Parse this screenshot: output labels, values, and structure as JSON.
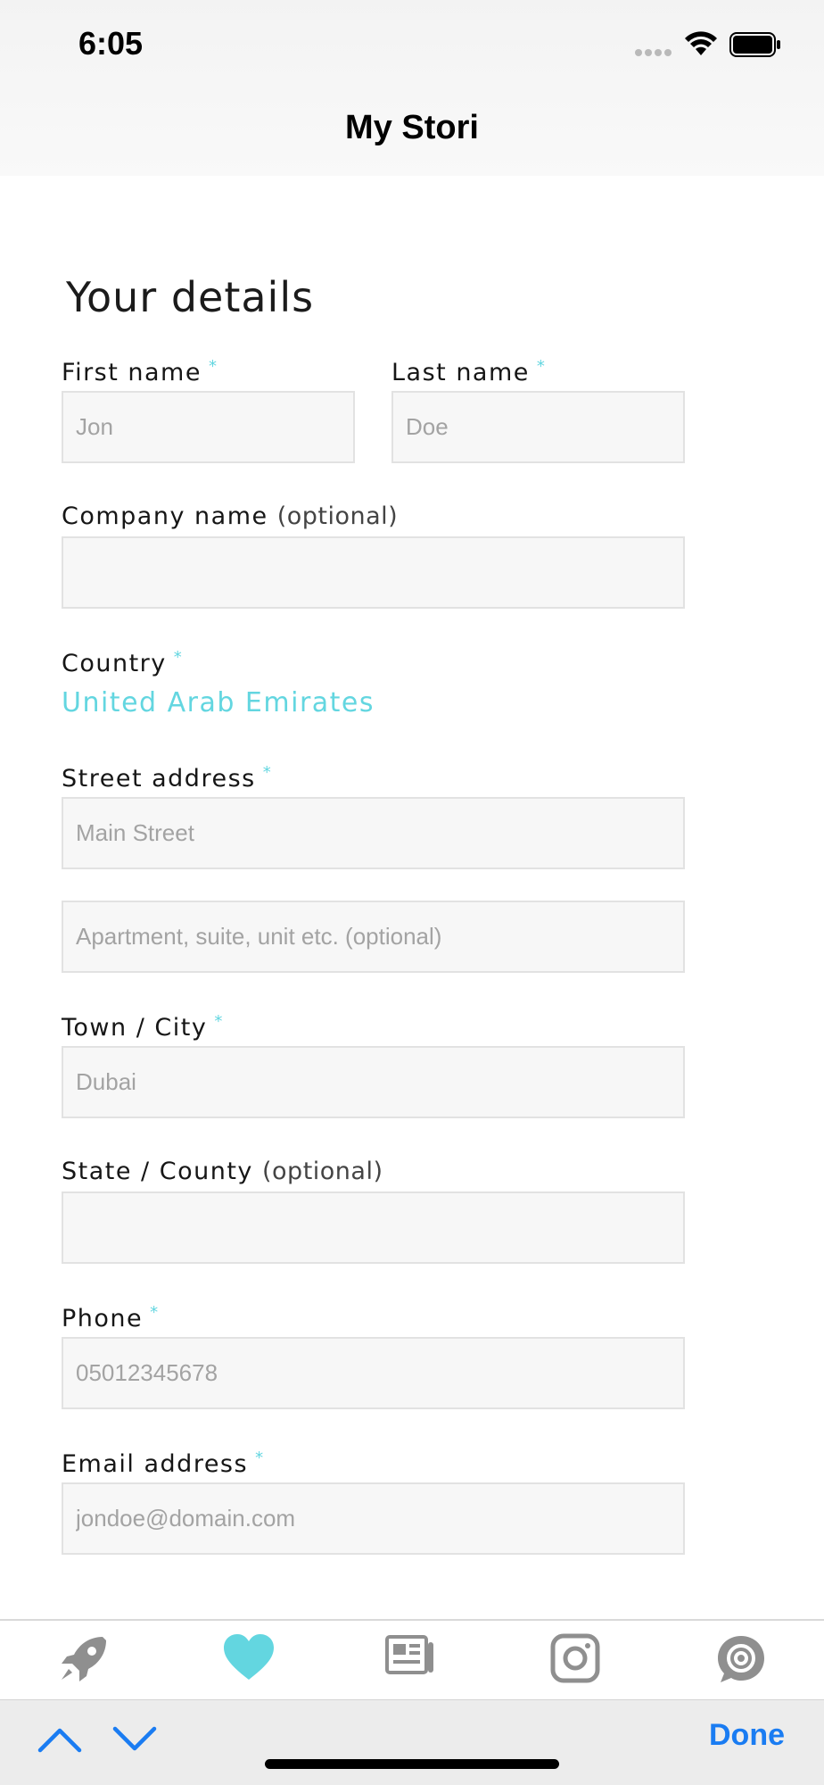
{
  "status_bar": {
    "time": "6:05"
  },
  "nav": {
    "title": "My Stori"
  },
  "form": {
    "section_title": "Your details",
    "required_mark": "*",
    "first_name": {
      "label": "First name",
      "placeholder": "Jon"
    },
    "last_name": {
      "label": "Last name",
      "placeholder": "Doe"
    },
    "company": {
      "label": "Company name",
      "optional": "(optional)",
      "value": ""
    },
    "country": {
      "label": "Country",
      "value": "United Arab Emirates"
    },
    "street": {
      "label": "Street address",
      "placeholder": "Main Street",
      "placeholder2": "Apartment, suite, unit etc. (optional)"
    },
    "city": {
      "label": "Town / City",
      "placeholder": "Dubai"
    },
    "state": {
      "label": "State / County",
      "optional": "(optional)",
      "value": ""
    },
    "phone": {
      "label": "Phone",
      "placeholder": "05012345678"
    },
    "email": {
      "label": "Email address",
      "placeholder": "jondoe@domain.com"
    }
  },
  "tab_bar": {
    "items": [
      {
        "icon": "rocket-icon",
        "active": false
      },
      {
        "icon": "heart-icon",
        "active": true
      },
      {
        "icon": "newspaper-icon",
        "active": false
      },
      {
        "icon": "instagram-icon",
        "active": false
      },
      {
        "icon": "help-icon",
        "active": false
      }
    ]
  },
  "keyboard_accessory": {
    "done_label": "Done"
  },
  "colors": {
    "accent": "#63d6e0",
    "done_blue": "#1a7cf2",
    "icon_gray": "#8f8f8f"
  }
}
